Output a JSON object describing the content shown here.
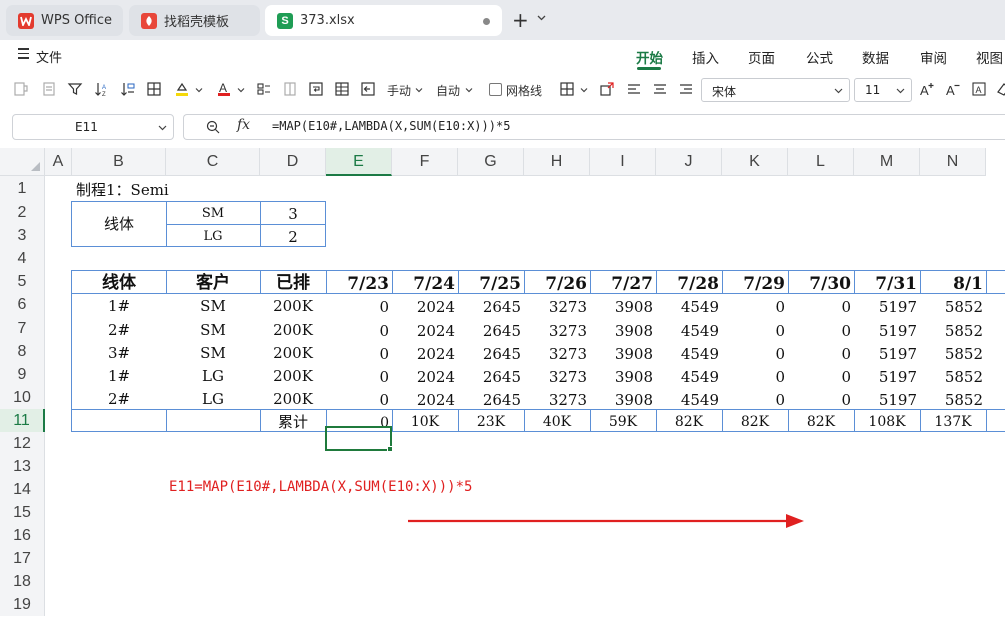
{
  "tabs": [
    {
      "label": "WPS Office",
      "icon": "wps-logo-icon"
    },
    {
      "label": "找稻壳模板",
      "icon": "docer-icon"
    },
    {
      "label": "373.xlsx",
      "icon": "spreadsheet-s-icon"
    }
  ],
  "tab_icon_letters": {
    "sheet": "S",
    "wps": "W"
  },
  "menu": {
    "file": "文件",
    "ribbon_tabs": [
      "开始",
      "插入",
      "页面",
      "公式",
      "数据",
      "审阅",
      "视图"
    ],
    "active_tab": "开始"
  },
  "toolbar": {
    "manual": "手动",
    "auto": "自动",
    "gridlines": "网格线",
    "font": "宋体",
    "font_size": "11"
  },
  "formula_bar": {
    "cell_ref": "E11",
    "fx": "fx",
    "formula": "=MAP(E10#,LAMBDA(X,SUM(E10:X)))*5"
  },
  "columns": [
    "A",
    "B",
    "C",
    "D",
    "E",
    "F",
    "G",
    "H",
    "I",
    "J",
    "K",
    "L",
    "M",
    "N"
  ],
  "rows": [
    "1",
    "2",
    "3",
    "4",
    "5",
    "6",
    "7",
    "8",
    "9",
    "10",
    "11",
    "12",
    "13",
    "14",
    "15",
    "16",
    "17",
    "18",
    "19"
  ],
  "selected_column": "E",
  "selected_row": "11",
  "sheet": {
    "process_label": "制程1：Semi",
    "small_table": {
      "line_label": "线体",
      "rows": [
        [
          "SM",
          "3"
        ],
        [
          "LG",
          "2"
        ]
      ]
    },
    "main_table": {
      "headers": [
        "线体",
        "客户",
        "已排",
        "7/23",
        "7/24",
        "7/25",
        "7/26",
        "7/27",
        "7/28",
        "7/29",
        "7/30",
        "7/31",
        "8/1"
      ],
      "rows": [
        [
          "1#",
          "SM",
          "200K",
          "0",
          "2024",
          "2645",
          "3273",
          "3908",
          "4549",
          "0",
          "0",
          "5197",
          "5852"
        ],
        [
          "2#",
          "SM",
          "200K",
          "0",
          "2024",
          "2645",
          "3273",
          "3908",
          "4549",
          "0",
          "0",
          "5197",
          "5852"
        ],
        [
          "3#",
          "SM",
          "200K",
          "0",
          "2024",
          "2645",
          "3273",
          "3908",
          "4549",
          "0",
          "0",
          "5197",
          "5852"
        ],
        [
          "1#",
          "LG",
          "200K",
          "0",
          "2024",
          "2645",
          "3273",
          "3908",
          "4549",
          "0",
          "0",
          "5197",
          "5852"
        ],
        [
          "2#",
          "LG",
          "200K",
          "0",
          "2024",
          "2645",
          "3273",
          "3908",
          "4549",
          "0",
          "0",
          "5197",
          "5852"
        ]
      ],
      "total_label": "累计",
      "totals": [
        "0",
        "10K",
        "23K",
        "40K",
        "59K",
        "82K",
        "82K",
        "82K",
        "108K",
        "137K"
      ]
    },
    "note": "E11=MAP(E10#,LAMBDA(X,SUM(E10:X)))*5"
  },
  "colors": {
    "accent_green": "#1b7a45",
    "note_red": "#e02020",
    "table_border": "#5b8fd6"
  }
}
